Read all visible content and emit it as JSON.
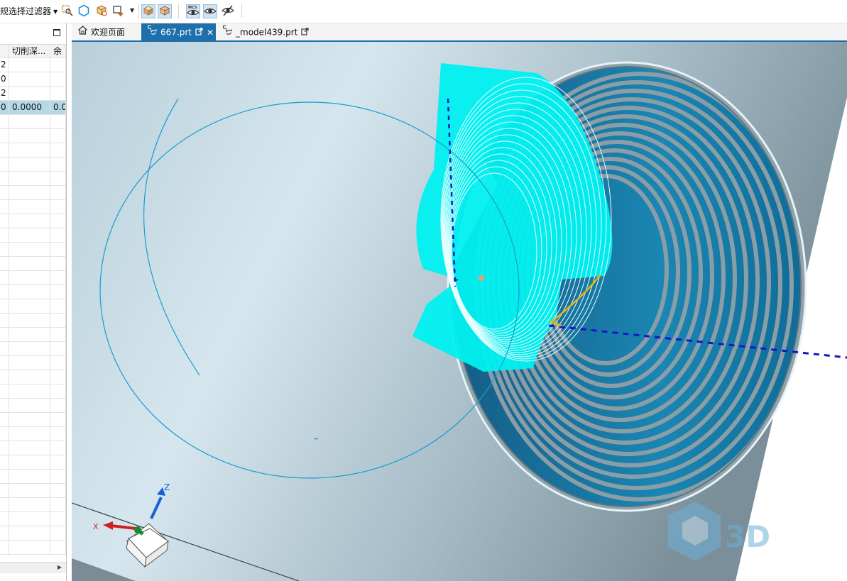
{
  "toolbar": {
    "filter_label": "规选择过滤器",
    "icons": [
      "selection-filter-icon",
      "face-hexagon-icon",
      "solid-body-icon",
      "point-snap-icon",
      "shaded-view-icon",
      "wireframe-view-icon",
      "mcs-view-icon",
      "show-hide-icon",
      "hide-icon"
    ]
  },
  "left_panel": {
    "columns": [
      "",
      "切削深...",
      "余"
    ],
    "rows": [
      [
        "2",
        "",
        ""
      ],
      [
        "0",
        "",
        ""
      ],
      [
        "2",
        "",
        ""
      ],
      [
        "0",
        "0.0000",
        "0.0"
      ]
    ],
    "selected_row": 3
  },
  "tabs": [
    {
      "label": "欢迎页面",
      "icon": "home-icon",
      "active": false
    },
    {
      "label": "667.prt",
      "icon": "part-file-icon",
      "active": true
    },
    {
      "label": "_model439.prt",
      "icon": "part-file-icon",
      "active": false
    }
  ],
  "viewport": {
    "axes": {
      "x": "X",
      "z": "Z"
    },
    "watermark": "3D",
    "colors": {
      "toolpath": "#00f0f0",
      "thread": "#1a86b3",
      "body": "#b4cbd6",
      "axis_dashed": "#1616c8",
      "engage": "#e8b80c"
    }
  }
}
